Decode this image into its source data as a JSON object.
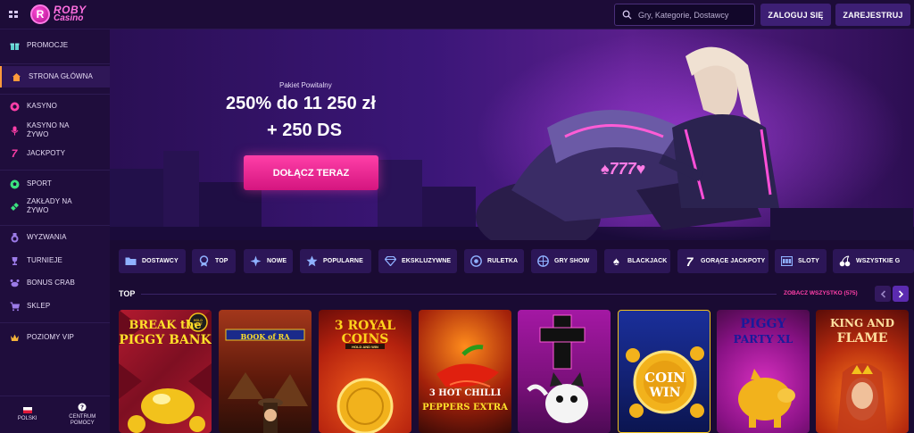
{
  "brand": {
    "line1": "ROBY",
    "line2": "Casino",
    "badge": "R"
  },
  "search": {
    "placeholder": "Gry, Kategorie, Dostawcy"
  },
  "header": {
    "login_label": "ZALOGUJ SIĘ",
    "register_label": "ZAREJESTRUJ"
  },
  "sidebar": {
    "items": [
      {
        "label": "PROMOCJE",
        "icon": "gift-icon"
      },
      {
        "label": "STRONA GŁÓWNA",
        "icon": "home-icon",
        "active": true
      },
      {
        "label": "KASYNO",
        "icon": "chip-icon"
      },
      {
        "label": "KASYNO NA ŻYWO",
        "icon": "microphone-icon"
      },
      {
        "label": "JACKPOTY",
        "icon": "seven-icon"
      },
      {
        "label": "SPORT",
        "icon": "football-icon"
      },
      {
        "label": "ZAKŁADY NA ŻYWO",
        "icon": "ticket-icon"
      },
      {
        "label": "WYZWANIA",
        "icon": "medal-icon"
      },
      {
        "label": "TURNIEJE",
        "icon": "trophy-icon"
      },
      {
        "label": "BONUS CRAB",
        "icon": "crab-icon"
      },
      {
        "label": "SKLEP",
        "icon": "cart-icon"
      },
      {
        "label": "POZIOMY VIP",
        "icon": "crown-icon"
      }
    ],
    "bottom": [
      {
        "label": "POLSKI",
        "icon": "poland-flag-icon"
      },
      {
        "label": "CENTRUM POMOCY",
        "icon": "help-icon"
      }
    ]
  },
  "hero": {
    "subtitle": "Pakiet Powitalny",
    "title_line1": "250% do 11 250 zł",
    "title_line2": "+ 250 DS",
    "cta_label": "DOŁĄCZ TERAZ",
    "bike_text": "777"
  },
  "categories": [
    {
      "label": "DOSTAWCY",
      "icon": "folder-icon"
    },
    {
      "label": "TOP",
      "icon": "badge-icon"
    },
    {
      "label": "NOWE",
      "icon": "sparkle-icon"
    },
    {
      "label": "POPULARNE",
      "icon": "star-icon"
    },
    {
      "label": "EKSKLUZYWNE",
      "icon": "diamond-icon"
    },
    {
      "label": "RULETKA",
      "icon": "roulette-icon"
    },
    {
      "label": "GRY SHOW",
      "icon": "show-icon"
    },
    {
      "label": "BLACKJACK",
      "icon": "spade-icon"
    },
    {
      "label": "GORĄCE JACKPOTY",
      "icon": "seven-icon"
    },
    {
      "label": "SLOTY",
      "icon": "slot-icon"
    },
    {
      "label": "WSZYSTKIE G",
      "icon": "cherry-icon"
    }
  ],
  "section": {
    "title": "TOP",
    "see_all_label": "ZOBACZ WSZYSTKO (575)"
  },
  "games": [
    {
      "title_top": "BREAK the",
      "title_bottom": "PIGGY BANK",
      "badge": "HOLD HUNT"
    },
    {
      "title_top": "BOOK of RA"
    },
    {
      "title_top": "3 ROYAL",
      "title_bottom": "COINS",
      "sub": "HOLD AND WIN"
    },
    {
      "title_top": "3 HOT CHILLI",
      "title_bottom": "PEPPERS EXTRA"
    },
    {
      "title_top": ""
    },
    {
      "title_top": "COIN",
      "title_bottom": "WIN"
    },
    {
      "title_top": "PIGGY",
      "title_bottom": "PARTY XL"
    },
    {
      "title_top": "KING AND",
      "title_bottom": "FLAME"
    }
  ],
  "colors": {
    "accent": "#ff3fa8",
    "bg": "#1a0b33",
    "sidebar": "#1f0d3c",
    "chip": "#2c1657",
    "active_border": "#ff9a3c"
  }
}
